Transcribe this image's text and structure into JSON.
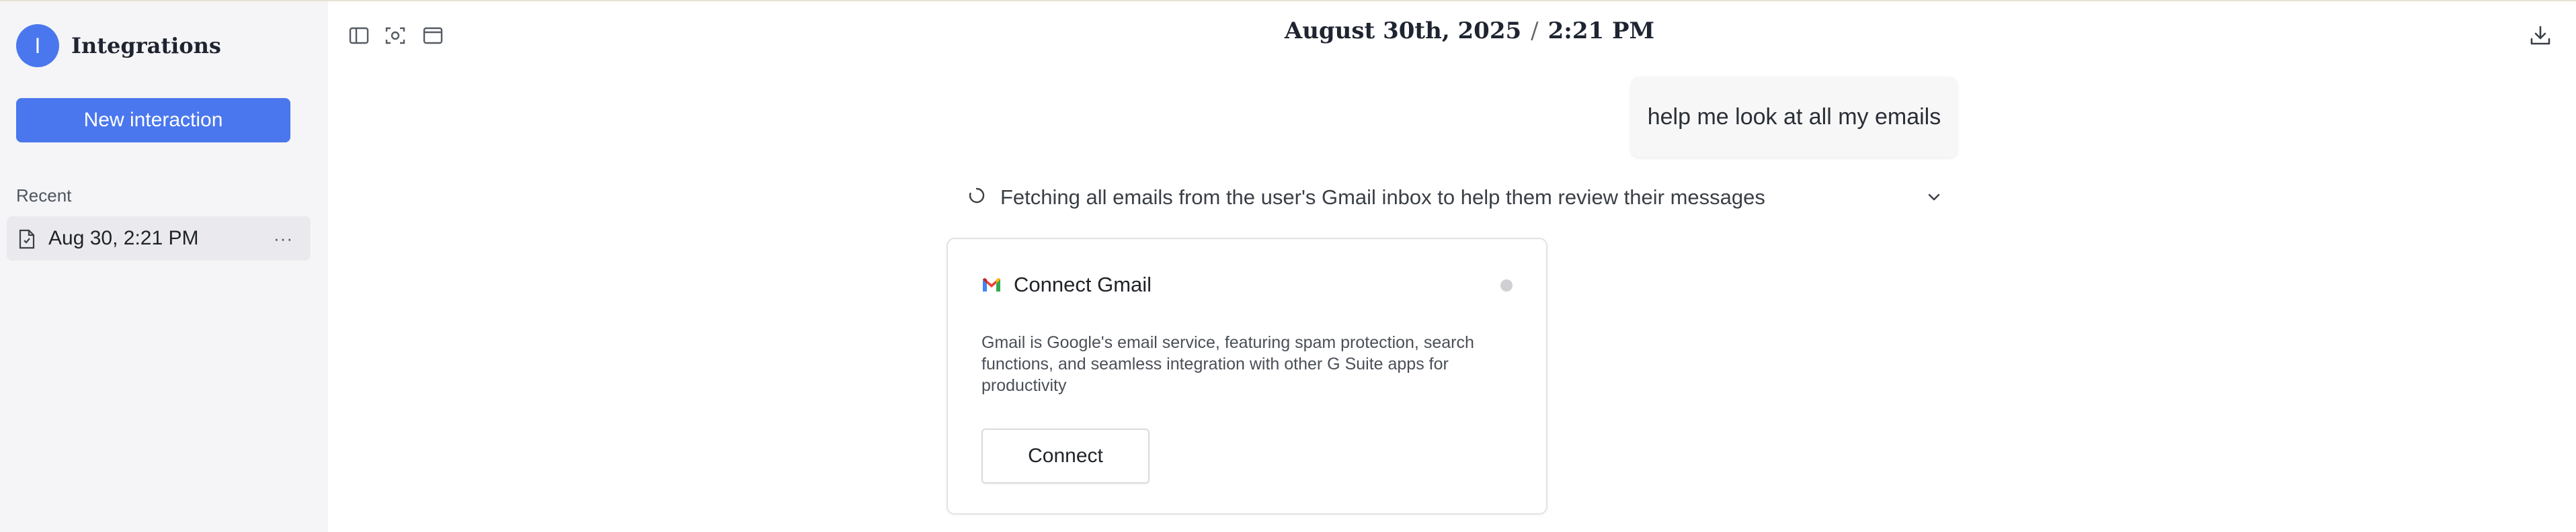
{
  "sidebar": {
    "brand_initial": "I",
    "brand_title": "Integrations",
    "new_button": "New interaction",
    "recent_label": "Recent",
    "recent_items": [
      {
        "label": "Aug 30, 2:21 PM",
        "more": "···"
      }
    ]
  },
  "header": {
    "date": "August 30th, 2025",
    "separator": "/",
    "time": "2:21 PM"
  },
  "chat": {
    "user_message": "help me look at all my emails",
    "status_text": "Fetching all emails from the user's Gmail inbox to help them review their messages"
  },
  "card": {
    "title": "Connect Gmail",
    "description": "Gmail is Google's email service, featuring spam protection, search functions, and seamless integration with other G Suite apps for productivity",
    "connect_label": "Connect"
  },
  "colors": {
    "accent": "#4a77ee",
    "sidebar_bg": "#f5f5f7",
    "status_dot": "#cfd0d4"
  },
  "icons": [
    "sidebar-toggle-icon",
    "screenshot-icon",
    "browser-window-icon",
    "download-icon",
    "document-icon",
    "spinner-icon",
    "chevron-down-icon",
    "gmail-icon"
  ]
}
